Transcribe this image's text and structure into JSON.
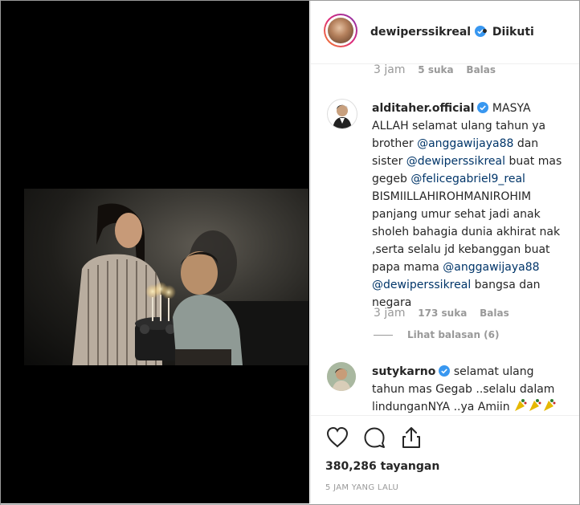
{
  "header": {
    "username": "dewiperssikreal",
    "follow_status": "• Diikuti"
  },
  "top_meta": {
    "time": "3 jam",
    "likes": "5 suka",
    "reply": "Balas"
  },
  "comments": [
    {
      "username": "alditaher.official",
      "segments": [
        {
          "text": " MASYA ALLAH selamat ulang tahun ya brother ",
          "mention": false
        },
        {
          "text": "@anggawijaya88",
          "mention": true
        },
        {
          "text": " dan sister ",
          "mention": false
        },
        {
          "text": "@dewiperssikreal",
          "mention": true
        },
        {
          "text": " buat mas gegeb ",
          "mention": false
        },
        {
          "text": "@felicegabriel9_real",
          "mention": true
        },
        {
          "text": " BISMIILLAHIROHMANIROHIM panjang umur sehat jadi anak sholeh bahagia dunia akhirat nak ,serta selalu jd kebanggan buat papa mama ",
          "mention": false
        },
        {
          "text": "@anggawijaya88",
          "mention": true
        },
        {
          "text": " ",
          "mention": false
        },
        {
          "text": "@dewiperssikreal",
          "mention": true
        },
        {
          "text": " bangsa dan negara",
          "mention": false
        }
      ],
      "time": "3 jam",
      "likes": "173 suka",
      "reply": "Balas",
      "view_replies": "Lihat balasan (6)"
    },
    {
      "username": "sutykarno",
      "segments": [
        {
          "text": " selamat ulang tahun mas Gegab ..selalu dalam lindunganNYA ..ya Amiin",
          "mention": false
        }
      ]
    }
  ],
  "actions": {
    "like_icon": "heart-icon",
    "comment_icon": "comment-icon",
    "share_icon": "share-icon"
  },
  "views": "380,286 tayangan",
  "timestamp": "5 JAM YANG LALU",
  "colors": {
    "verified": "#3897f0",
    "mention": "#003569",
    "muted": "#999999",
    "text": "#262626"
  }
}
